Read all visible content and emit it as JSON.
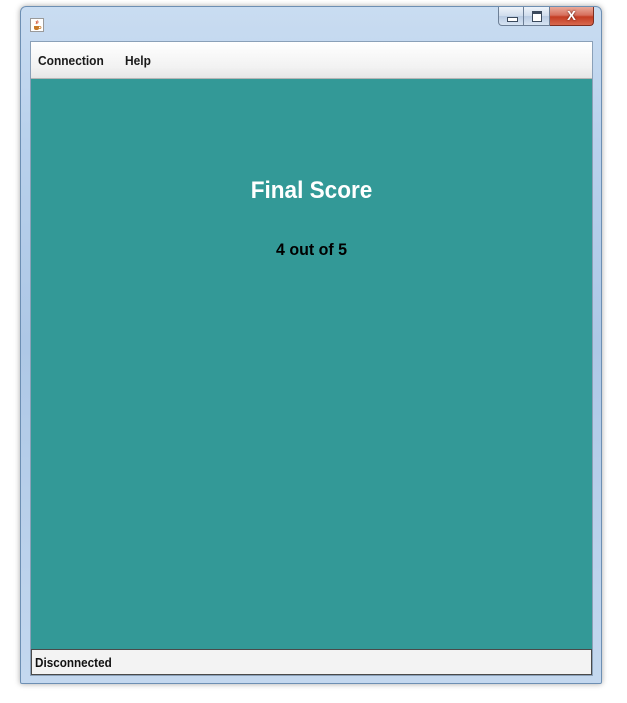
{
  "window": {
    "icon": "java-cup-icon",
    "controls": {
      "minimize": "minimize-icon",
      "maximize": "maximize-icon",
      "close_label": "X"
    }
  },
  "menubar": {
    "items": [
      {
        "label": "Connection"
      },
      {
        "label": "Help"
      }
    ]
  },
  "main": {
    "background": "#339997",
    "title": "Final Score",
    "score": "4 out of 5"
  },
  "statusbar": {
    "text": "Disconnected"
  }
}
